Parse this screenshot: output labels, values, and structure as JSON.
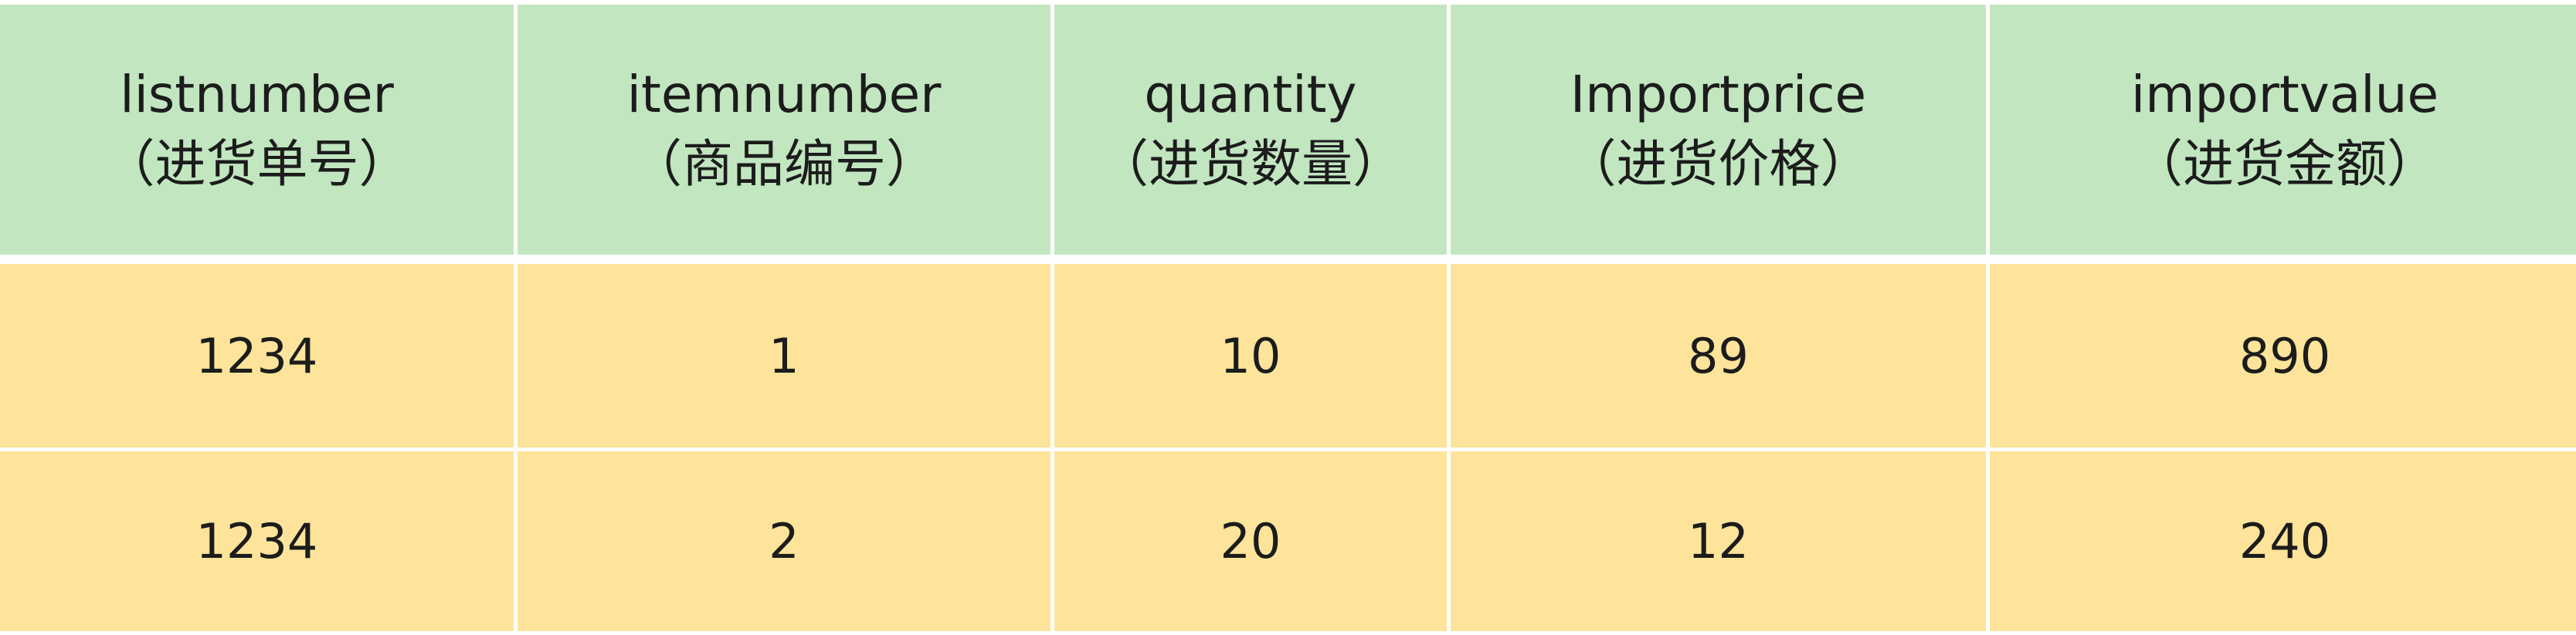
{
  "table": {
    "columns": [
      {
        "name": "listnumber",
        "label": "（进货单号）"
      },
      {
        "name": "itemnumber",
        "label": "（商品编号）"
      },
      {
        "name": "quantity",
        "label": "（进货数量）"
      },
      {
        "name": "Importprice",
        "label": "（进货价格）"
      },
      {
        "name": "importvalue",
        "label": "（进货金额）"
      }
    ],
    "rows": [
      [
        "1234",
        "1",
        "10",
        "89",
        "890"
      ],
      [
        "1234",
        "2",
        "20",
        "12",
        "240"
      ]
    ]
  },
  "colors": {
    "header_bg": "#c1e6c0",
    "row_bg": "#fde49a",
    "grid_line": "#ffffff"
  }
}
